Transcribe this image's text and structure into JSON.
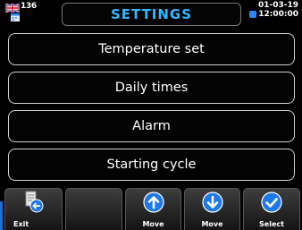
{
  "header": {
    "language_code": "136",
    "title": "SETTINGS",
    "date": "01-03-19",
    "time": "12:00:00"
  },
  "menu": {
    "items": [
      {
        "label": "Temperature set"
      },
      {
        "label": "Daily times"
      },
      {
        "label": "Alarm"
      },
      {
        "label": "Starting cycle"
      }
    ]
  },
  "toolbar": {
    "buttons": [
      {
        "label": "Exit",
        "icon": "exit-icon"
      },
      {
        "label": "",
        "icon": ""
      },
      {
        "label": "Move",
        "icon": "arrow-up-icon"
      },
      {
        "label": "Move",
        "icon": "arrow-down-icon"
      },
      {
        "label": "Select",
        "icon": "check-icon"
      }
    ]
  },
  "colors": {
    "title": "#33b6ff",
    "icon_blue": "#2a86ff",
    "border": "#d0d0d0"
  }
}
